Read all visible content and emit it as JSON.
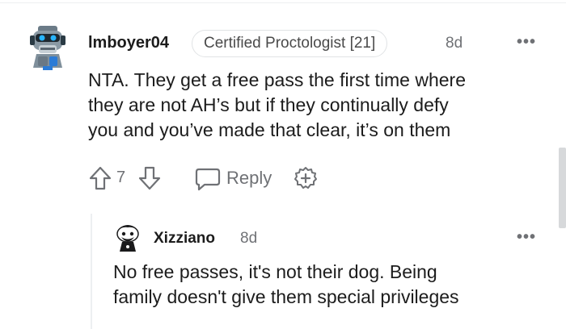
{
  "comment": {
    "username": "lmboyer04",
    "flair": "Certified Proctologist [21]",
    "time": "8d",
    "more": "•••",
    "body_lines": [
      "NTA. They get a free pass the first time where",
      "they are not AH’s but if they continually defy",
      "you and you’ve made that clear, it’s on them"
    ],
    "vote_count": "7",
    "reply_label": "Reply",
    "avatar_icon": "robot-avatar-icon"
  },
  "reply": {
    "username": "Xizziano",
    "time": "8d",
    "more": "•••",
    "body_lines": [
      "No free passes, it's not their dog. Being",
      "family doesn't give them special privileges"
    ],
    "avatar_icon": "snoo-avatar-icon"
  },
  "colors": {
    "text": "#1c1c1c",
    "meta": "#6f7175",
    "divider": "#edeff1"
  }
}
